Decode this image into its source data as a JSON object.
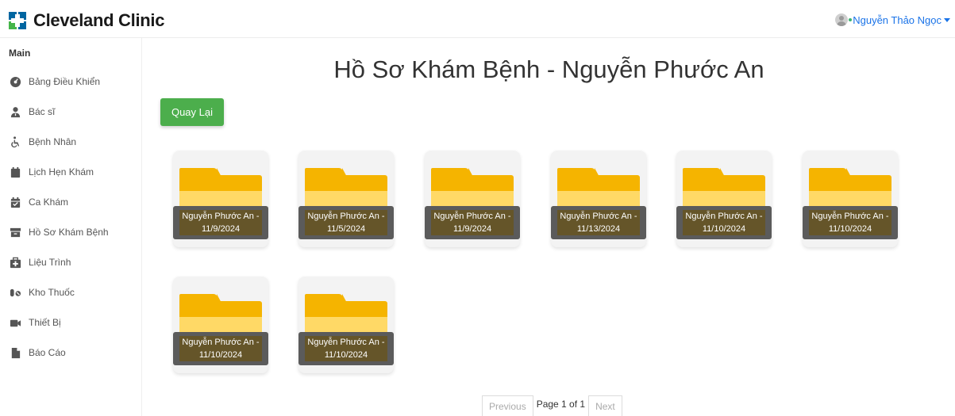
{
  "header": {
    "brand": "Cleveland Clinic",
    "user_name": "Nguyễn Thảo Ngọc"
  },
  "sidebar": {
    "heading": "Main",
    "items": [
      {
        "label": "Bảng Điều Khiển",
        "icon": "dashboard-icon"
      },
      {
        "label": "Bác sĩ",
        "icon": "doctor-icon"
      },
      {
        "label": "Bệnh Nhân",
        "icon": "wheelchair-icon"
      },
      {
        "label": "Lịch Hẹn Khám",
        "icon": "calendar-icon"
      },
      {
        "label": "Ca Khám",
        "icon": "calendar-check-icon"
      },
      {
        "label": "Hồ Sơ Khám Bệnh",
        "icon": "archive-icon"
      },
      {
        "label": "Liệu Trình",
        "icon": "medical-kit-icon"
      },
      {
        "label": "Kho Thuốc",
        "icon": "pills-icon"
      },
      {
        "label": "Thiết Bị",
        "icon": "video-camera-icon"
      },
      {
        "label": "Báo Cáo",
        "icon": "file-icon"
      }
    ]
  },
  "main": {
    "title": "Hồ Sơ Khám Bệnh - Nguyễn Phước An",
    "back_label": "Quay Lại",
    "records": [
      {
        "name": "Nguyễn Phước An -",
        "date": "11/9/2024"
      },
      {
        "name": "Nguyễn Phước An -",
        "date": "11/5/2024"
      },
      {
        "name": "Nguyễn Phước An -",
        "date": "11/9/2024"
      },
      {
        "name": "Nguyễn Phước An -",
        "date": "11/13/2024"
      },
      {
        "name": "Nguyễn Phước An -",
        "date": "11/10/2024"
      },
      {
        "name": "Nguyễn Phước An -",
        "date": "11/10/2024"
      },
      {
        "name": "Nguyễn Phước An -",
        "date": "11/10/2024"
      },
      {
        "name": "Nguyễn Phước An -",
        "date": "11/10/2024"
      }
    ]
  },
  "pagination": {
    "previous": "Previous",
    "info": "Page 1 of 1",
    "next": "Next"
  },
  "colors": {
    "back_button": "#4cae4c",
    "folder": "#ffd966",
    "folder_tab": "#f5b400",
    "user_link": "#1a73e8"
  }
}
